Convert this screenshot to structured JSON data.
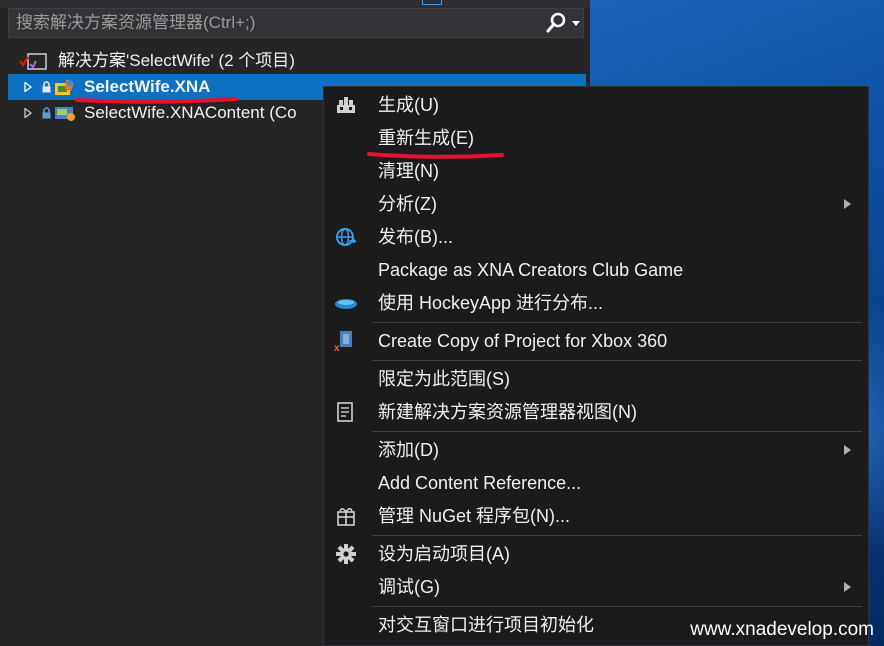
{
  "search": {
    "placeholder": "搜索解决方案资源管理器(Ctrl+;)"
  },
  "tree": {
    "solution_label": "解决方案'SelectWife' (2 个项目)",
    "project_selected": "SelectWife.XNA",
    "project_content": "SelectWife.XNAContent (Co"
  },
  "menu": {
    "build": "生成(U)",
    "rebuild": "重新生成(E)",
    "clean": "清理(N)",
    "analyze": "分析(Z)",
    "publish": "发布(B)...",
    "package_xna": "Package as XNA Creators Club Game",
    "hockeyapp": "使用 HockeyApp 进行分布...",
    "copy_xbox": "Create Copy of Project for Xbox 360",
    "scope": "限定为此范围(S)",
    "new_view": "新建解决方案资源管理器视图(N)",
    "add": "添加(D)",
    "add_content_ref": "Add Content Reference...",
    "nuget": "管理 NuGet 程序包(N)...",
    "startup": "设为启动项目(A)",
    "debug": "调试(G)",
    "interactive": "对交互窗口进行项目初始化"
  },
  "watermark": "www.xnadevelop.com",
  "colors": {
    "selection": "#0e70c0",
    "annotation_red": "#e8112d",
    "menu_bg": "#1b1b1c",
    "panel_bg": "#252526"
  }
}
